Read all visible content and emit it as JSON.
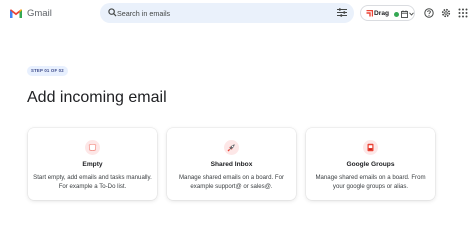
{
  "app": {
    "name": "Gmail"
  },
  "search": {
    "placeholder": "Search in emails"
  },
  "toolbar": {
    "drag_label": "Drag"
  },
  "colors": {
    "accent": "#ea4335",
    "status_green": "#34a853",
    "search_bg": "#eaf1fb",
    "badge_bg": "#e8f0fe"
  },
  "wizard": {
    "step_label": "STEP 01 OF 02",
    "title": "Add incoming email",
    "options": [
      {
        "icon": "sticky-note-icon",
        "title": "Empty",
        "description": "Start empty, add emails and tasks manually. For example a To-Do list."
      },
      {
        "icon": "rocket-icon",
        "title": "Shared Inbox",
        "description": "Manage shared emails on a board. For example support@ or sales@."
      },
      {
        "icon": "google-groups-icon",
        "title": "Google Groups",
        "description": "Manage shared emails on a board. From your google groups or alias."
      }
    ]
  }
}
